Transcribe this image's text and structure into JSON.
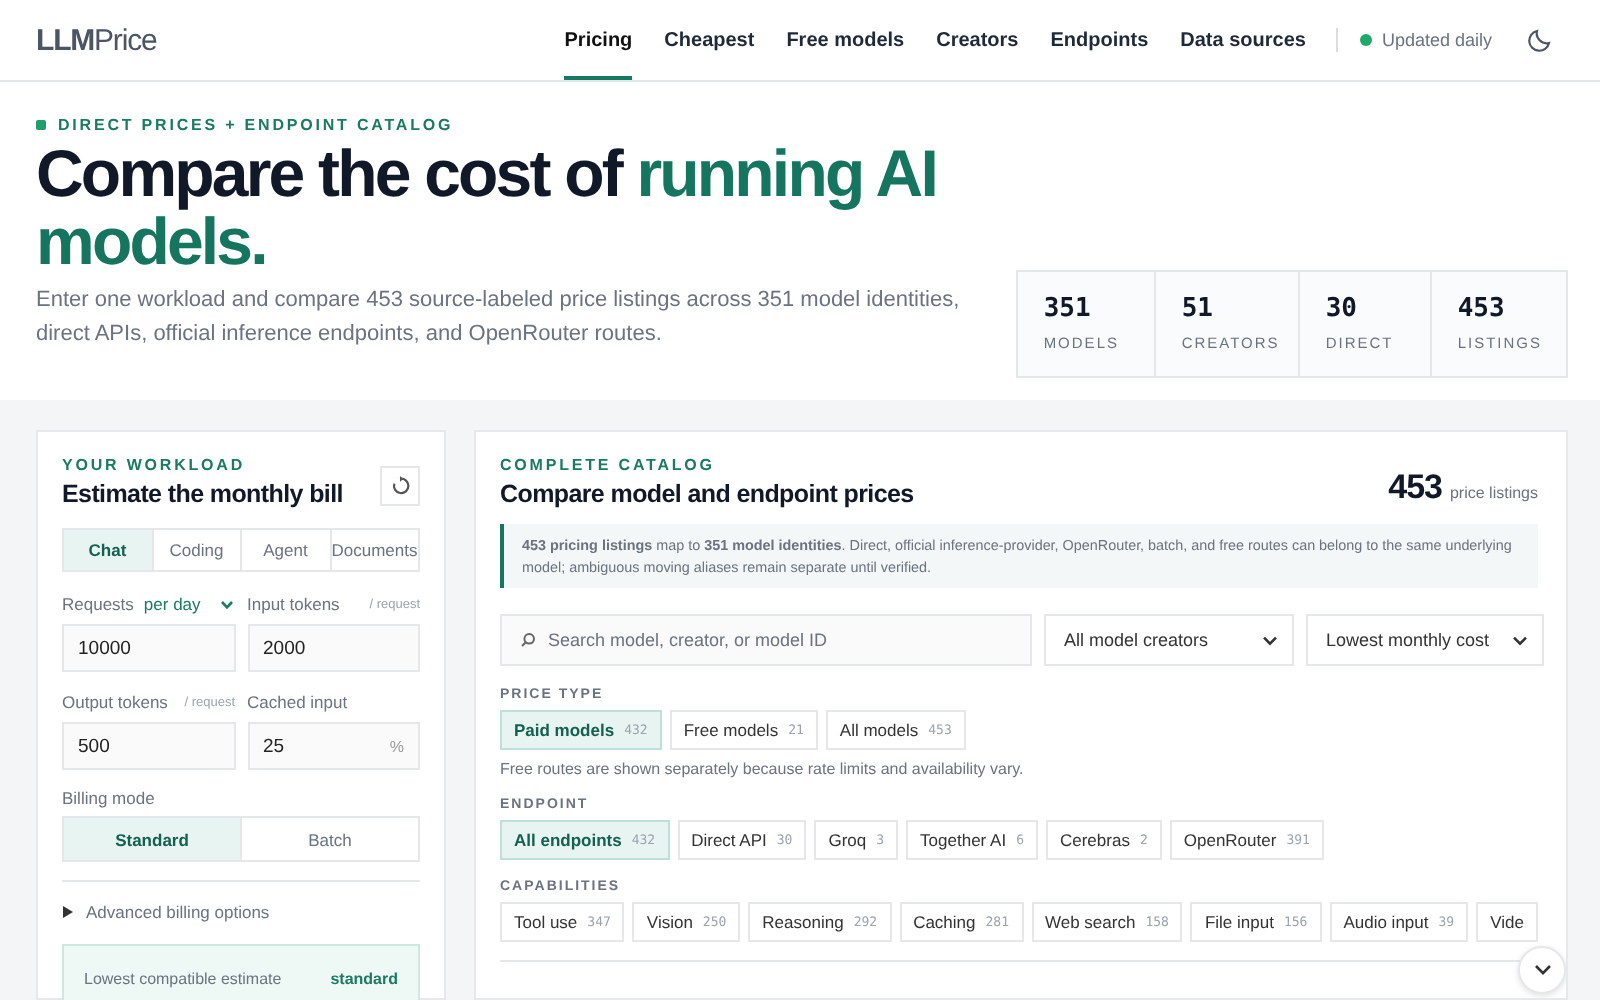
{
  "header": {
    "brand": "**LLM**Price",
    "nav": [
      {
        "label": "Pricing",
        "selected": true
      },
      {
        "label": "Cheapest",
        "selected": false
      },
      {
        "label": "Free models",
        "selected": false
      },
      {
        "label": "Creators",
        "selected": false
      },
      {
        "label": "Endpoints",
        "selected": false
      },
      {
        "label": "Data sources",
        "selected": false
      }
    ],
    "status": "Updated daily"
  },
  "hero": {
    "eyebrow": "DIRECT PRICES + ENDPOINT CATALOG",
    "title": "Compare the cost of",
    "title_highlight": "running AI models.",
    "description": "Enter one workload and compare 453 source-labeled price listings across 351 model identities, direct APIs, official inference endpoints, and OpenRouter routes.",
    "stats": [
      {
        "value": "351",
        "label": "MODELS"
      },
      {
        "value": "51",
        "label": "CREATORS"
      },
      {
        "value": "30",
        "label": "DIRECT"
      },
      {
        "value": "453",
        "label": "LISTINGS"
      }
    ]
  },
  "workload": {
    "eyebrow": "YOUR WORKLOAD",
    "title": "Estimate the monthly bill",
    "presets": [
      {
        "label": "Chat",
        "selected": true
      },
      {
        "label": "Coding",
        "selected": false
      },
      {
        "label": "Agent",
        "selected": false
      },
      {
        "label": "Documents",
        "selected": false
      }
    ],
    "fields": [
      {
        "label": "Requests",
        "period": "per day",
        "value": "10000"
      },
      {
        "label": "Input tokens",
        "hint": "/ request",
        "value": "2000"
      },
      {
        "label": "Output tokens",
        "hint": "/ request",
        "value": "500"
      },
      {
        "label": "Cached input",
        "value": "25",
        "unit": "%"
      }
    ],
    "billing_label": "Billing mode",
    "billing_modes": [
      {
        "label": "Standard",
        "selected": true
      },
      {
        "label": "Batch",
        "selected": false
      }
    ],
    "advanced": {
      "label": "Advanced billing options",
      "expanded": false
    },
    "estimate": {
      "label": "Lowest compatible estimate",
      "mode": "standard"
    }
  },
  "catalog": {
    "eyebrow": "COMPLETE CATALOG",
    "title": "Compare model and endpoint prices",
    "count": "453",
    "count_label": "price listings",
    "note": "**453 pricing listings** map to **351 model identities**. Direct, official inference-provider, OpenRouter, batch, and free routes can belong to the same underlying model; ambiguous moving aliases remain separate until verified.",
    "search": {
      "placeholder": "Search model, creator, or model ID"
    },
    "selects": [
      "All model creators",
      "Lowest monthly cost"
    ],
    "filters": [
      {
        "title": "PRICE TYPE",
        "chips": [
          {
            "label": "Paid models",
            "count": "432",
            "selected": true
          },
          {
            "label": "Free models",
            "count": "21",
            "selected": false
          },
          {
            "label": "All models",
            "count": "453",
            "selected": false
          }
        ],
        "note": "Free routes are shown separately because rate limits and availability vary."
      },
      {
        "title": "ENDPOINT",
        "chips": [
          {
            "label": "All endpoints",
            "count": "432",
            "selected": true
          },
          {
            "label": "Direct API",
            "count": "30",
            "selected": false
          },
          {
            "label": "Groq",
            "count": "3",
            "selected": false
          },
          {
            "label": "Together AI",
            "count": "6",
            "selected": false
          },
          {
            "label": "Cerebras",
            "count": "2",
            "selected": false
          },
          {
            "label": "OpenRouter",
            "count": "391",
            "selected": false
          }
        ]
      },
      {
        "title": "CAPABILITIES",
        "chips": [
          {
            "label": "Tool use",
            "count": "347",
            "selected": false
          },
          {
            "label": "Vision",
            "count": "250",
            "selected": false
          },
          {
            "label": "Reasoning",
            "count": "292",
            "selected": false
          },
          {
            "label": "Caching",
            "count": "281",
            "selected": false
          },
          {
            "label": "Web search",
            "count": "158",
            "selected": false
          },
          {
            "label": "File input",
            "count": "156",
            "selected": false
          },
          {
            "label": "Audio input",
            "count": "39",
            "selected": false
          },
          {
            "label": "Vide",
            "selected": false
          }
        ]
      }
    ]
  }
}
